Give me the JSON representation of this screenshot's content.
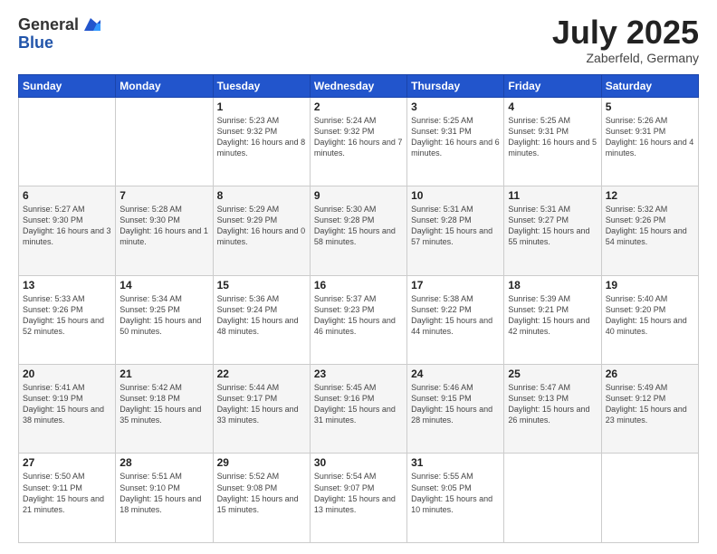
{
  "header": {
    "logo": {
      "general": "General",
      "blue": "Blue"
    },
    "title": "July 2025",
    "location": "Zaberfeld, Germany"
  },
  "days_of_week": [
    "Sunday",
    "Monday",
    "Tuesday",
    "Wednesday",
    "Thursday",
    "Friday",
    "Saturday"
  ],
  "weeks": [
    [
      null,
      null,
      {
        "day": 1,
        "sunrise": "5:23 AM",
        "sunset": "9:32 PM",
        "daylight": "16 hours and 8 minutes."
      },
      {
        "day": 2,
        "sunrise": "5:24 AM",
        "sunset": "9:32 PM",
        "daylight": "16 hours and 7 minutes."
      },
      {
        "day": 3,
        "sunrise": "5:25 AM",
        "sunset": "9:31 PM",
        "daylight": "16 hours and 6 minutes."
      },
      {
        "day": 4,
        "sunrise": "5:25 AM",
        "sunset": "9:31 PM",
        "daylight": "16 hours and 5 minutes."
      },
      {
        "day": 5,
        "sunrise": "5:26 AM",
        "sunset": "9:31 PM",
        "daylight": "16 hours and 4 minutes."
      }
    ],
    [
      {
        "day": 6,
        "sunrise": "5:27 AM",
        "sunset": "9:30 PM",
        "daylight": "16 hours and 3 minutes."
      },
      {
        "day": 7,
        "sunrise": "5:28 AM",
        "sunset": "9:30 PM",
        "daylight": "16 hours and 1 minute."
      },
      {
        "day": 8,
        "sunrise": "5:29 AM",
        "sunset": "9:29 PM",
        "daylight": "16 hours and 0 minutes."
      },
      {
        "day": 9,
        "sunrise": "5:30 AM",
        "sunset": "9:28 PM",
        "daylight": "15 hours and 58 minutes."
      },
      {
        "day": 10,
        "sunrise": "5:31 AM",
        "sunset": "9:28 PM",
        "daylight": "15 hours and 57 minutes."
      },
      {
        "day": 11,
        "sunrise": "5:31 AM",
        "sunset": "9:27 PM",
        "daylight": "15 hours and 55 minutes."
      },
      {
        "day": 12,
        "sunrise": "5:32 AM",
        "sunset": "9:26 PM",
        "daylight": "15 hours and 54 minutes."
      }
    ],
    [
      {
        "day": 13,
        "sunrise": "5:33 AM",
        "sunset": "9:26 PM",
        "daylight": "15 hours and 52 minutes."
      },
      {
        "day": 14,
        "sunrise": "5:34 AM",
        "sunset": "9:25 PM",
        "daylight": "15 hours and 50 minutes."
      },
      {
        "day": 15,
        "sunrise": "5:36 AM",
        "sunset": "9:24 PM",
        "daylight": "15 hours and 48 minutes."
      },
      {
        "day": 16,
        "sunrise": "5:37 AM",
        "sunset": "9:23 PM",
        "daylight": "15 hours and 46 minutes."
      },
      {
        "day": 17,
        "sunrise": "5:38 AM",
        "sunset": "9:22 PM",
        "daylight": "15 hours and 44 minutes."
      },
      {
        "day": 18,
        "sunrise": "5:39 AM",
        "sunset": "9:21 PM",
        "daylight": "15 hours and 42 minutes."
      },
      {
        "day": 19,
        "sunrise": "5:40 AM",
        "sunset": "9:20 PM",
        "daylight": "15 hours and 40 minutes."
      }
    ],
    [
      {
        "day": 20,
        "sunrise": "5:41 AM",
        "sunset": "9:19 PM",
        "daylight": "15 hours and 38 minutes."
      },
      {
        "day": 21,
        "sunrise": "5:42 AM",
        "sunset": "9:18 PM",
        "daylight": "15 hours and 35 minutes."
      },
      {
        "day": 22,
        "sunrise": "5:44 AM",
        "sunset": "9:17 PM",
        "daylight": "15 hours and 33 minutes."
      },
      {
        "day": 23,
        "sunrise": "5:45 AM",
        "sunset": "9:16 PM",
        "daylight": "15 hours and 31 minutes."
      },
      {
        "day": 24,
        "sunrise": "5:46 AM",
        "sunset": "9:15 PM",
        "daylight": "15 hours and 28 minutes."
      },
      {
        "day": 25,
        "sunrise": "5:47 AM",
        "sunset": "9:13 PM",
        "daylight": "15 hours and 26 minutes."
      },
      {
        "day": 26,
        "sunrise": "5:49 AM",
        "sunset": "9:12 PM",
        "daylight": "15 hours and 23 minutes."
      }
    ],
    [
      {
        "day": 27,
        "sunrise": "5:50 AM",
        "sunset": "9:11 PM",
        "daylight": "15 hours and 21 minutes."
      },
      {
        "day": 28,
        "sunrise": "5:51 AM",
        "sunset": "9:10 PM",
        "daylight": "15 hours and 18 minutes."
      },
      {
        "day": 29,
        "sunrise": "5:52 AM",
        "sunset": "9:08 PM",
        "daylight": "15 hours and 15 minutes."
      },
      {
        "day": 30,
        "sunrise": "5:54 AM",
        "sunset": "9:07 PM",
        "daylight": "15 hours and 13 minutes."
      },
      {
        "day": 31,
        "sunrise": "5:55 AM",
        "sunset": "9:05 PM",
        "daylight": "15 hours and 10 minutes."
      },
      null,
      null
    ]
  ]
}
